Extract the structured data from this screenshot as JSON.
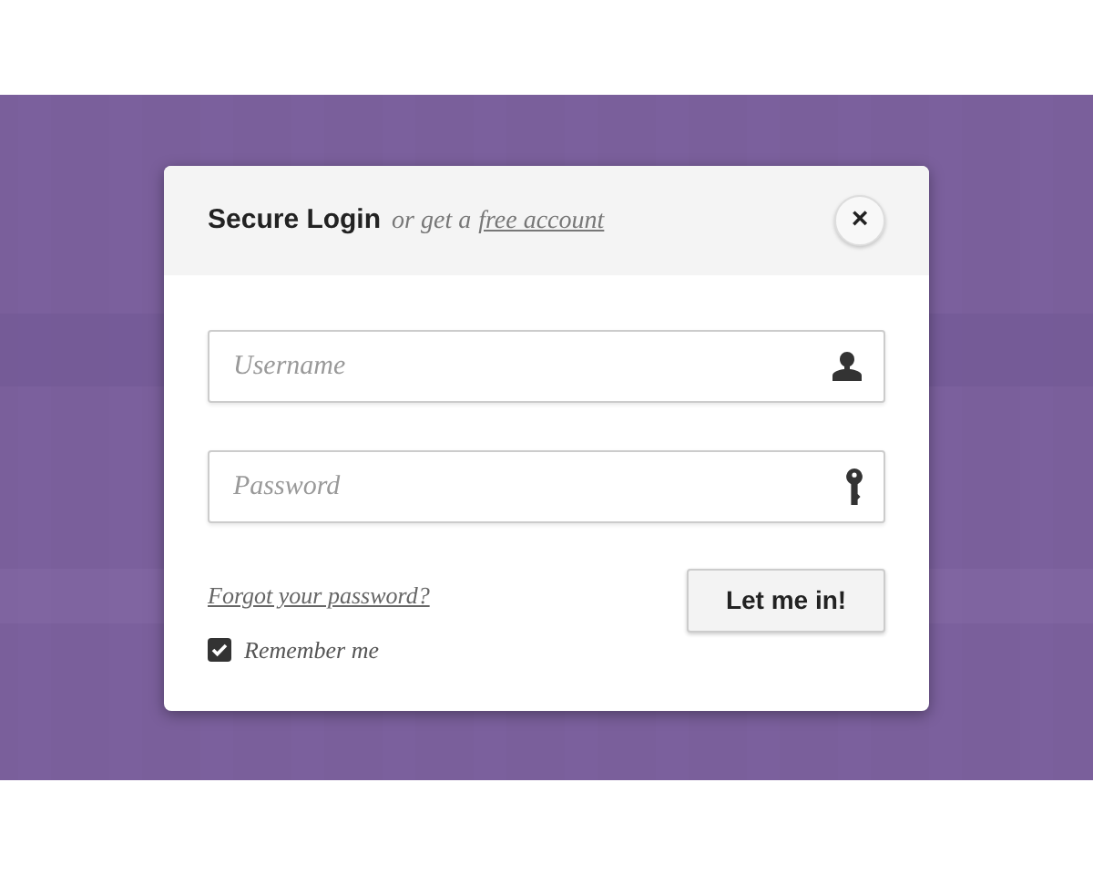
{
  "dialog": {
    "title": "Secure Login",
    "subtitle": "or get a",
    "signup_link": "free account",
    "close": "×"
  },
  "fields": [
    {
      "placeholder": "Username",
      "kind": "user"
    },
    {
      "placeholder": "Password",
      "kind": "key"
    }
  ],
  "forgot_link": "Forgot your password?",
  "remember": {
    "label": "Remember me",
    "checked": true
  },
  "submit": "Let me in!"
}
